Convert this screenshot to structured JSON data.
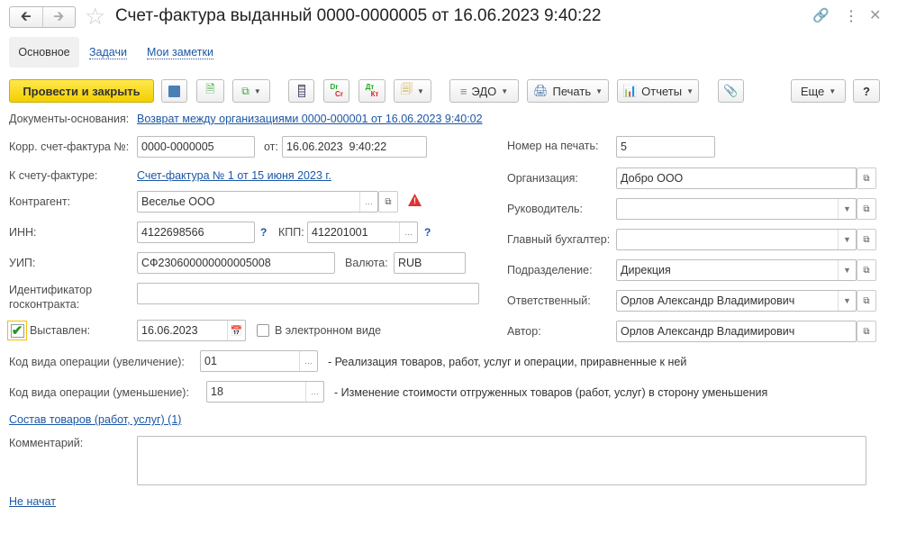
{
  "header": {
    "title": "Счет-фактура выданный 0000-0000005 от 16.06.2023 9:40:22"
  },
  "tabs": [
    "Основное",
    "Задачи",
    "Мои заметки"
  ],
  "toolbar": {
    "post_close": "Провести и закрыть",
    "edo": "ЭДО",
    "print": "Печать",
    "reports": "Отчеты",
    "more": "Еще",
    "help": "?",
    "dr": "Dr",
    "cr": "Cr",
    "dt": "Дт",
    "kt": "Кт"
  },
  "basis": {
    "label": "Документы-основания:",
    "link": "Возврат между организациями 0000-000001 от 16.06.2023 9:40:02"
  },
  "form": {
    "corr_label": "Корр. счет-фактура №:",
    "corr_value": "0000-0000005",
    "from_label": "от:",
    "from_value": "16.06.2023  9:40:22",
    "to_invoice_label": "К счету-фактуре:",
    "to_invoice_link": "Счет-фактура № 1 от 15 июня 2023 г.",
    "counterparty_label": "Контрагент:",
    "counterparty_value": "Веселье ООО",
    "inn_label": "ИНН:",
    "inn_value": "4122698566",
    "kpp_label": "КПП:",
    "kpp_value": "412201001",
    "q": "?",
    "uip_label": "УИП:",
    "uip_value": "СФ230600000000005008",
    "currency_label": "Валюта:",
    "currency_value": "RUB",
    "contract_label_1": "Идентификатор",
    "contract_label_2": "госконтракта:",
    "contract_value": "",
    "issued_label": "Выставлен:",
    "issued_checked": true,
    "issued_date": "16.06.2023",
    "electronic_label": "В электронном виде",
    "electronic_checked": false,
    "op_inc_label": "Код вида операции (увеличение):",
    "op_inc_value": "01",
    "op_inc_desc": "- Реализация товаров, работ, услуг и операции, приравненные к ней",
    "op_dec_label": "Код вида операции (уменьшение):",
    "op_dec_value": "18",
    "op_dec_desc": "- Изменение стоимости отгруженных товаров (работ, услуг) в сторону уменьшения",
    "goods_link": "Состав товаров (работ, услуг) (1)",
    "comment_label": "Комментарий:",
    "comment_value": "",
    "status_link": "Не начат",
    "print_no_label": "Номер на печать:",
    "print_no_value": "5",
    "org_label": "Организация:",
    "org_value": "Добро ООО",
    "head_label": "Руководитель:",
    "head_value": "",
    "accountant_label": "Главный бухгалтер:",
    "accountant_value": "",
    "dept_label": "Подразделение:",
    "dept_value": "Дирекция",
    "resp_label": "Ответственный:",
    "resp_value": "Орлов Александр Владимирович",
    "author_label": "Автор:",
    "author_value": "Орлов Александр Владимирович"
  }
}
